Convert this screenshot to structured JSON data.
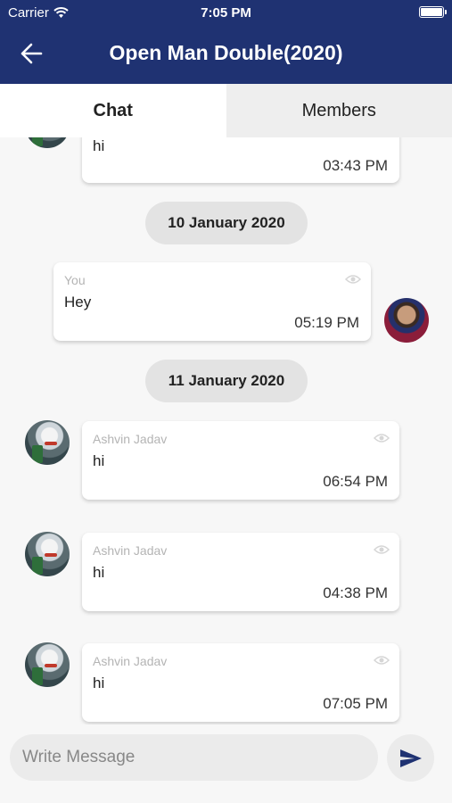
{
  "status_bar": {
    "carrier": "Carrier",
    "time": "7:05 PM"
  },
  "header": {
    "title": "Open Man Double(2020)"
  },
  "tabs": [
    {
      "label": "Chat",
      "active": true
    },
    {
      "label": "Members",
      "active": false
    }
  ],
  "messages": [
    {
      "sender": "",
      "text": "hi",
      "time": "03:43 PM"
    },
    {
      "date": "10 January 2020"
    },
    {
      "sender": "You",
      "text": "Hey",
      "time": "05:19 PM"
    },
    {
      "date": "11 January 2020"
    },
    {
      "sender": "Ashvin Jadav",
      "text": "hi",
      "time": "06:54 PM"
    },
    {
      "sender": "Ashvin Jadav",
      "text": "hi",
      "time": "04:38 PM"
    },
    {
      "sender": "Ashvin Jadav",
      "text": "hi",
      "time": "07:05 PM"
    }
  ],
  "composer": {
    "placeholder": "Write Message",
    "value": ""
  },
  "colors": {
    "header_bg": "#1f3272",
    "send_icon": "#1f3272"
  },
  "icons": [
    "back-arrow-icon",
    "wifi-icon",
    "battery-icon",
    "eye-icon",
    "send-icon"
  ]
}
